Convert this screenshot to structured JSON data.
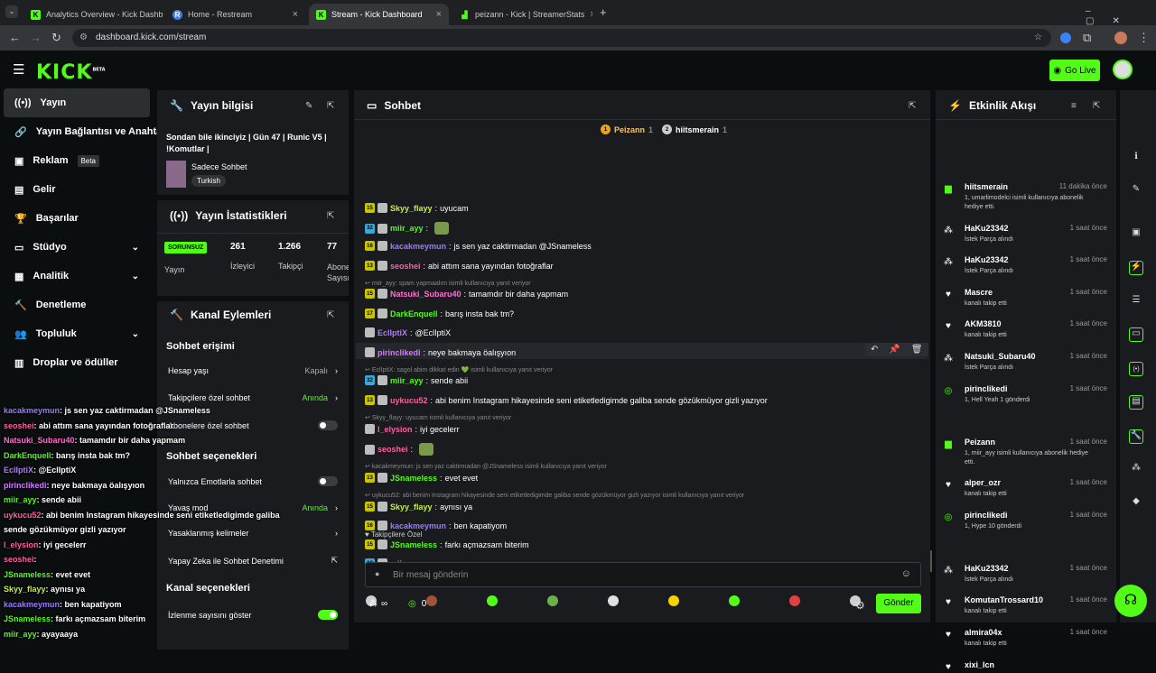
{
  "browser": {
    "tabs": [
      {
        "title": "Analytics Overview - Kick Dashb"
      },
      {
        "title": "Home - Restream"
      },
      {
        "title": "Stream - Kick Dashboard"
      },
      {
        "title": "peizann - Kick | StreamerStats"
      }
    ],
    "url": "dashboard.kick.com/stream",
    "new_tab": "+"
  },
  "header": {
    "logo": "KICK",
    "logo_sup": "BETA",
    "go_live": "Go Live"
  },
  "sidebar": {
    "items": [
      {
        "label": "Yayın"
      },
      {
        "label": "Yayın Bağlantısı ve Anahtarı"
      },
      {
        "label": "Reklam",
        "badge": "Beta"
      },
      {
        "label": "Gelir"
      },
      {
        "label": "Başarılar"
      },
      {
        "label": "Stüdyo"
      },
      {
        "label": "Analitik"
      },
      {
        "label": "Denetleme"
      },
      {
        "label": "Topluluk"
      },
      {
        "label": "Droplar ve ödüller"
      }
    ]
  },
  "stream_info": {
    "title": "Yayın bilgisi",
    "stream_title": "Sondan bile ikinciyiz | Gün 47 | Runic V5 | !Komutlar |",
    "category": "Sadece Sohbet",
    "tag": "Turkish"
  },
  "stats": {
    "title": "Yayın İstatistikleri",
    "status": "SORUNSUZ",
    "status_label": "Yayın",
    "viewers": "261",
    "viewers_label": "İzleyici",
    "followers": "1.266",
    "followers_label": "Takipçi",
    "subs": "77",
    "subs_label": "Abone Sayısı"
  },
  "channel_actions": {
    "title": "Kanal Eylemleri",
    "chat_access": "Sohbet erişimi",
    "account_age": "Hesap yaşı",
    "account_age_value": "Kapalı",
    "followers_only": "Takipçilere özel sohbet",
    "followers_only_value": "Anında",
    "subs_only": "Abonelere özel sohbet",
    "chat_options": "Sohbet seçenekleri",
    "emote_only": "Yalnızca Emotlarla sohbet",
    "slow_mode": "Yavaş mod",
    "slow_mode_value": "Anında",
    "banned_words": "Yasaklanmış kelimeler",
    "ai_moderation": "Yapay Zeka ile Sohbet Denetimi",
    "channel_options": "Kanal seçenekleri",
    "show_viewers": "İzlenme sayısını göster"
  },
  "chat": {
    "title": "Sohbet",
    "top1": "Peizann",
    "top1_count": "1",
    "top2": "hiitsmerain",
    "top2_count": "1",
    "messages": [
      {
        "badge": "15",
        "user": "Skyy_flayy",
        "color": "#c2f04a",
        "text": "uyucam"
      },
      {
        "badge": "32",
        "user": "miir_ayy",
        "color": "#53fc18",
        "text": ""
      },
      {
        "badge": "16",
        "user": "kacakmeymun",
        "color": "#9b7bff",
        "text": "js sen yaz caktirmadan @JSnameless"
      },
      {
        "badge": "13",
        "user": "seoshei",
        "color": "#ff5fa2",
        "text": "abi attım sana yayından fotoğraflar"
      },
      {
        "reply": "miir_ayy: spam yapmaalım isimli kullanıcıya yanıt veriyor"
      },
      {
        "badge": "15",
        "user": "Natsuki_Subaru40",
        "color": "#ff6fd0",
        "text": "tamamdır bir daha yapmam"
      },
      {
        "badge": "17",
        "user": "DarkEnquell",
        "color": "#53fc18",
        "text": "barış insta bak tm?"
      },
      {
        "badge": "",
        "user": "EclIptiX",
        "color": "#b07bff",
        "text": "@EclIptiX"
      },
      {
        "badge": "",
        "user": "pirinclikedi",
        "color": "#d47bff",
        "text": "neye bakmaya öalışyıon"
      },
      {
        "reply": "EclIptiX: sagol abim dikkat edin 💚 isimli kullanıcıya yanıt veriyor"
      },
      {
        "badge": "32",
        "user": "miir_ayy",
        "color": "#53fc18",
        "text": "sende abii"
      },
      {
        "badge": "13",
        "user": "uykucu52",
        "color": "#ff5fa2",
        "text": "abi benim Instagram hikayesinde seni etiketledigimde galiba sende gözükmüyor gizli yazıyor"
      },
      {
        "reply": "Skyy_flayy: uyucam isimli kullanıcıya yanıt veriyor"
      },
      {
        "badge": "",
        "user": "l_elysion",
        "color": "#ff5fa2",
        "text": "iyi gecelerr"
      },
      {
        "badge": "",
        "user": "seoshei",
        "color": "#ff5fa2",
        "text": ""
      },
      {
        "reply": "kacakmeymun: js sen yaz caktirmadan @JSnameless isimli kullanıcıya yanıt veriyor"
      },
      {
        "badge": "13",
        "user": "JSnameless",
        "color": "#53fc18",
        "text": "evet evet"
      },
      {
        "reply": "uykucu52: abi benim Instagram hikayesinde seni etiketledigimde galiba sende gözükmüyor gizli yazıyor isimli kullanıcıya yanıt veriyor"
      },
      {
        "badge": "15",
        "user": "Skyy_flayy",
        "color": "#c2f04a",
        "text": "aynısı ya"
      },
      {
        "badge": "16",
        "user": "kacakmeymun",
        "color": "#9b7bff",
        "text": "ben kapatiyom"
      },
      {
        "badge": "15",
        "user": "JSnameless",
        "color": "#53fc18",
        "text": "farkı açmazsam biterim"
      },
      {
        "badge": "32",
        "user": "miir_ayy",
        "color": "#53fc18",
        "text": "ayayaaya"
      }
    ],
    "followers_only": "Takipçilere Özel",
    "input_placeholder": "Bir mesaj gönderin",
    "send": "Gönder",
    "points": "0",
    "infinite": "∞"
  },
  "events": {
    "title": "Etkinlik Akışı",
    "items": [
      {
        "name": "hiitsmerain",
        "time": "11 dakika önce",
        "desc": "1, umarlimodelci isimli kullanıcıya abonelik hediye etti.",
        "icon": "gift"
      },
      {
        "name": "HaKu23342",
        "time": "1 saat önce",
        "desc": "İstek Parça alındı",
        "icon": "points"
      },
      {
        "name": "HaKu23342",
        "time": "1 saat önce",
        "desc": "İstek Parça alındı",
        "icon": "points"
      },
      {
        "name": "Mascre",
        "time": "1 saat önce",
        "desc": "kanalı takip etti",
        "icon": "heart"
      },
      {
        "name": "AKM3810",
        "time": "1 saat önce",
        "desc": "kanalı takip etti",
        "icon": "heart"
      },
      {
        "name": "Natsuki_Subaru40",
        "time": "1 saat önce",
        "desc": "İstek Parça alındı",
        "icon": "points"
      },
      {
        "name": "pirinclikedi",
        "time": "1 saat önce",
        "desc": "1, Hell Yeah 1 gönderdi",
        "icon": "kicks"
      },
      {
        "name": "Peizann",
        "time": "1 saat önce",
        "desc": "1, miir_ayy isimli kullanıcıya abonelik hediye etti.",
        "icon": "gift"
      },
      {
        "name": "alper_ozr",
        "time": "1 saat önce",
        "desc": "kanalı takip etti",
        "icon": "heart"
      },
      {
        "name": "pirinclikedi",
        "time": "1 saat önce",
        "desc": "1, Hype 10 gönderdi",
        "icon": "kicks"
      },
      {
        "name": "HaKu23342",
        "time": "1 saat önce",
        "desc": "İstek Parça alındı",
        "icon": "points"
      },
      {
        "name": "KomutanTrossard10",
        "time": "1 saat önce",
        "desc": "kanalı takip etti",
        "icon": "heart"
      },
      {
        "name": "almira04x",
        "time": "1 saat önce",
        "desc": "kanalı takip etti",
        "icon": "heart"
      },
      {
        "name": "xixi_lcn",
        "time": "",
        "desc": "",
        "icon": "heart"
      }
    ]
  },
  "overlay": {
    "lines": [
      {
        "user": "kacakmeymun",
        "text": ": js sen yaz caktirmadan @JSnameless",
        "color": "#9b7bff"
      },
      {
        "user": "seoshei",
        "text": ": abi attım sana yayından fotoğraflar",
        "color": "#ff5fa2"
      },
      {
        "user": "Natsuki_Subaru40",
        "text": ": tamamdır bir daha yapmam",
        "color": "#ff6fd0"
      },
      {
        "user": "DarkEnquell",
        "text": ": barış insta bak tm?",
        "color": "#53fc18"
      },
      {
        "user": "EclIptiX",
        "text": ": @EclIptiX",
        "color": "#b07bff"
      },
      {
        "user": "pirinclikedi",
        "text": ": neye bakmaya öalışyıon",
        "color": "#d47bff"
      },
      {
        "user": "miir_ayy",
        "text": ": sende abii",
        "color": "#53fc18"
      },
      {
        "user": "uykucu52",
        "text": ": abi benim Instagram hikayesinde seni etiketledigimde galiba",
        "color": "#ff5fa2"
      },
      {
        "user": "",
        "text": "sende gözükmüyor gizli yazıyor",
        "color": "#fff"
      },
      {
        "user": "l_elysion",
        "text": ": iyi gecelerr",
        "color": "#ff5fa2"
      },
      {
        "user": "seoshei",
        "text": ":",
        "color": "#ff5fa2"
      },
      {
        "user": "JSnameless",
        "text": ": evet evet",
        "color": "#53fc18"
      },
      {
        "user": "Skyy_flayy",
        "text": ": aynısı ya",
        "color": "#c2f04a"
      },
      {
        "user": "kacakmeymun",
        "text": ": ben kapatiyom",
        "color": "#9b7bff"
      },
      {
        "user": "JSnameless",
        "text": ": farkı açmazsam biterim",
        "color": "#53fc18"
      },
      {
        "user": "miir_ayy",
        "text": ": ayayaaya",
        "color": "#53fc18"
      }
    ]
  }
}
